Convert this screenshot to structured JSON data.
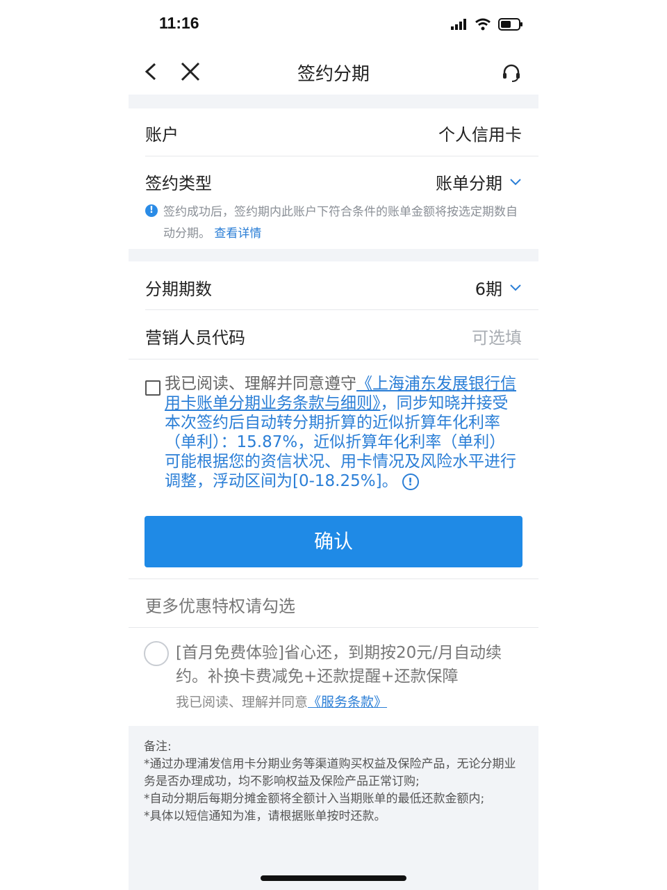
{
  "status_bar": {
    "time": "11:16"
  },
  "nav": {
    "title": "签约分期"
  },
  "fields": {
    "account": {
      "label": "账户",
      "value": "个人信用卡"
    },
    "sign_type": {
      "label": "签约类型",
      "value": "账单分期"
    },
    "tip": {
      "text": "签约成功后，签约期内此账户下符合条件的账单金额将按选定期数自动分期。",
      "link": "查看详情"
    },
    "periods": {
      "label": "分期期数",
      "value": "6期"
    },
    "sales_code": {
      "label": "营销人员代码",
      "placeholder": "可选填"
    }
  },
  "agreement": {
    "prefix": "我已阅读、理解并同意遵守",
    "link": "《上海浦东发展银行信用卡账单分期业务条款与细则》",
    "body": "，同步知晓并接受本次签约后自动转分期折算的近似折算年化利率（单利）：15.87%，近似折算年化利率（单利）可能根据您的资信状况、用卡情况及风险水平进行调整，浮动区间为[0-18.25%]。"
  },
  "confirm_button": "确认",
  "more": {
    "title": "更多优惠特权请勾选",
    "promo": "[首月免费体验]省心还，到期按20元/月自动续约。补换卡费减免+还款提醒+还款保障",
    "agree_prefix": "我已阅读、理解并同意",
    "agree_link": "《服务条款》"
  },
  "remarks": {
    "title": "备注:",
    "items": [
      "*通过办理浦发信用卡分期业务等渠道购买权益及保险产品，无论分期业务是否办理成功，均不影响权益及保险产品正常订购;",
      "*自动分期后每期分摊金额将全额计入当期账单的最低还款金额内;",
      "*具体以短信通知为准，请根据账单按时还款。"
    ]
  },
  "colors": {
    "accent": "#1f8ae6",
    "link": "#2a7ed6",
    "background_gray": "#f2f4f7"
  },
  "icons": [
    "signal-icon",
    "wifi-icon",
    "battery-icon",
    "back-icon",
    "close-icon",
    "headset-icon",
    "info-icon",
    "chevron-down-icon",
    "warning-icon"
  ]
}
